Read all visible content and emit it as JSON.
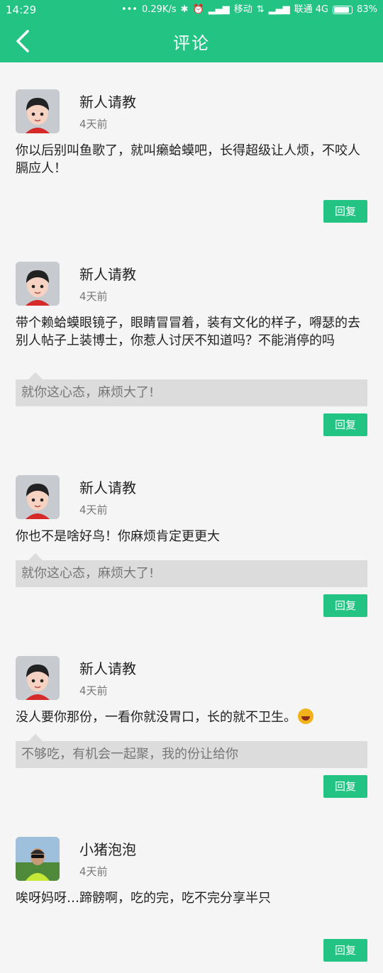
{
  "statusbar": {
    "time": "14:29",
    "network_speed": "0.29K/s",
    "carrier1": "移动",
    "carrier2": "联通 4G",
    "battery": "83%"
  },
  "appbar": {
    "title": "评论"
  },
  "comments": [
    {
      "user": "新人请教",
      "time": "4天前",
      "text": "你以后别叫鱼歌了，就叫癞蛤蟆吧，长得超级让人烦，不咬人膈应人！",
      "reply_label": "回复"
    },
    {
      "user": "新人请教",
      "time": "4天前",
      "text": "带个赖蛤蟆眼镜子，眼睛冒冒着，装有文化的样子，嘚瑟的去别人帖子上装博士，你惹人讨厌不知道吗？不能消停的吗",
      "quote": "就你这心态，麻烦大了!",
      "reply_label": "回复"
    },
    {
      "user": "新人请教",
      "time": "4天前",
      "text": "你也不是啥好鸟！你麻烦肯定更更大",
      "quote": "就你这心态，麻烦大了!",
      "reply_label": "回复"
    },
    {
      "user": "新人请教",
      "time": "4天前",
      "text": "没人要你那份，一看你就没胃口，长的就不卫生。",
      "quote": "不够吃，有机会一起聚，我的份让给你",
      "reply_label": "回复"
    },
    {
      "user": "小猪泡泡",
      "time": "4天前",
      "text": "唉呀妈呀…蹄髈啊，吃的完，吃不完分享半只",
      "reply_label": "回复"
    }
  ]
}
